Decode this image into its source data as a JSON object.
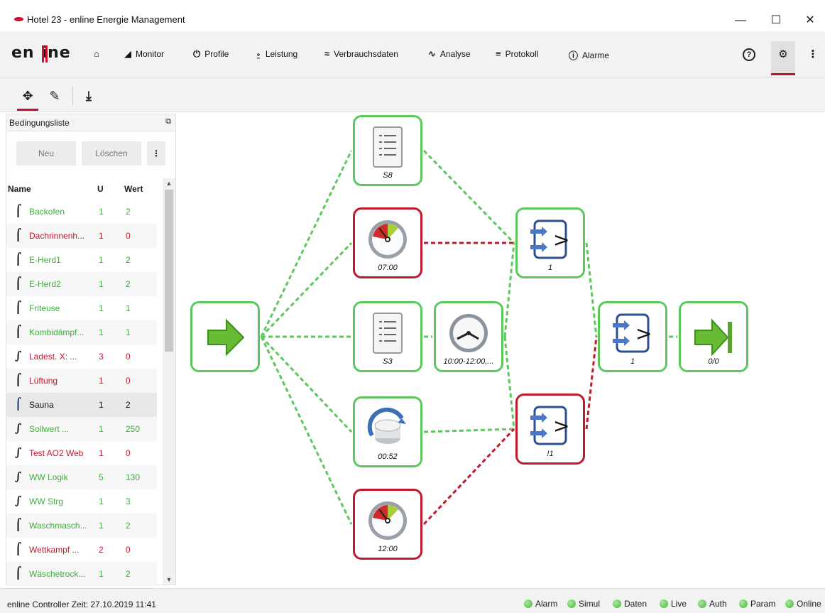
{
  "window": {
    "title": "Hotel 23 - enline Energie Management",
    "controls": [
      "—",
      "☐",
      "✕"
    ]
  },
  "brand": {
    "text": "enline"
  },
  "nav": [
    {
      "label": "",
      "icon": "home-icon",
      "glyph": "⌂"
    },
    {
      "label": "Monitor",
      "icon": "signal-icon",
      "glyph": "◢"
    },
    {
      "label": "Profile",
      "icon": "power-icon",
      "glyph": "⏻"
    },
    {
      "label": "Leistung",
      "icon": "plug-icon",
      "glyph": "⍛"
    },
    {
      "label": "Verbrauchsdaten",
      "icon": "trend-icon",
      "glyph": "≈"
    },
    {
      "label": "Analyse",
      "icon": "line-chart-icon",
      "glyph": "∿"
    },
    {
      "label": "Protokoll",
      "icon": "list-check-icon",
      "glyph": "≡"
    },
    {
      "label": "Alarme",
      "icon": "alert-icon",
      "glyph": "ⓘ"
    }
  ],
  "right_icons": [
    {
      "name": "help-icon",
      "glyph": "?"
    },
    {
      "name": "settings-icon",
      "glyph": "⚙"
    },
    {
      "name": "more-icon",
      "glyph": "⋮"
    }
  ],
  "toolbar": [
    {
      "name": "move-tool-icon",
      "glyph": "✥",
      "active": true
    },
    {
      "name": "edit-tool-icon",
      "glyph": "✎",
      "active": false
    },
    {
      "name": "download-icon",
      "glyph": "⤓",
      "active": false
    }
  ],
  "sidebar": {
    "title": "Bedingungsliste",
    "new_label": "Neu",
    "delete_label": "Löschen",
    "more_label": "⋮",
    "columns": {
      "name": "Name",
      "u": "U",
      "wert": "Wert"
    },
    "rows": [
      {
        "name": "Backofen",
        "u": "1",
        "w": "2",
        "color": "green"
      },
      {
        "name": "Dachrinnenh...",
        "u": "1",
        "w": "0",
        "color": "red"
      },
      {
        "name": "E-Herd1",
        "u": "1",
        "w": "2",
        "color": "green"
      },
      {
        "name": "E-Herd2",
        "u": "1",
        "w": "2",
        "color": "green"
      },
      {
        "name": "Friteuse",
        "u": "1",
        "w": "1",
        "color": "green"
      },
      {
        "name": "Kombidämpf...",
        "u": "1",
        "w": "1",
        "color": "green"
      },
      {
        "name": "Ladest. X: ...",
        "u": "3",
        "w": "0",
        "color": "red"
      },
      {
        "name": "Lüftung",
        "u": "1",
        "w": "0",
        "color": "red"
      },
      {
        "name": "Sauna",
        "u": "1",
        "w": "2",
        "color": "black"
      },
      {
        "name": "Sollwert ...",
        "u": "1",
        "w": "250",
        "color": "green"
      },
      {
        "name": "Test AO2 Web",
        "u": "1",
        "w": "0",
        "color": "red"
      },
      {
        "name": "WW Logik",
        "u": "5",
        "w": "130",
        "color": "green"
      },
      {
        "name": "WW Strg",
        "u": "1",
        "w": "3",
        "color": "green"
      },
      {
        "name": "Waschmasch...",
        "u": "1",
        "w": "2",
        "color": "green"
      },
      {
        "name": "Wettkampf ...",
        "u": "2",
        "w": "0",
        "color": "red"
      },
      {
        "name": "Wäschetrock...",
        "u": "1",
        "w": "2",
        "color": "green"
      }
    ]
  },
  "diagram": {
    "nodes": [
      {
        "id": "start",
        "kind": "start-arrow",
        "label": "",
        "state": "green"
      },
      {
        "id": "s8",
        "kind": "list",
        "label": "S8",
        "state": "green"
      },
      {
        "id": "gauge1",
        "kind": "gauge",
        "label": "07:00",
        "state": "red"
      },
      {
        "id": "s3",
        "kind": "list",
        "label": "S3",
        "state": "green"
      },
      {
        "id": "clock",
        "kind": "clock",
        "label": "10:00-12:00,...",
        "state": "green"
      },
      {
        "id": "knob",
        "kind": "knob",
        "label": "00:52",
        "state": "green"
      },
      {
        "id": "gauge2",
        "kind": "gauge",
        "label": "12:00",
        "state": "red"
      },
      {
        "id": "cmp1",
        "kind": "compare",
        "label": "1",
        "state": "green"
      },
      {
        "id": "cmp2",
        "kind": "compare",
        "label": "!1",
        "state": "red"
      },
      {
        "id": "cmp3",
        "kind": "compare",
        "label": "1",
        "state": "green"
      },
      {
        "id": "end",
        "kind": "end-arrow",
        "label": "0/0",
        "state": "green"
      }
    ],
    "edges": [
      {
        "from": "start",
        "to": "s8",
        "state": "green"
      },
      {
        "from": "start",
        "to": "gauge1",
        "state": "green"
      },
      {
        "from": "start",
        "to": "s3",
        "state": "green"
      },
      {
        "from": "start",
        "to": "knob",
        "state": "green"
      },
      {
        "from": "start",
        "to": "gauge2",
        "state": "green"
      },
      {
        "from": "s8",
        "to": "cmp1",
        "state": "green"
      },
      {
        "from": "gauge1",
        "to": "cmp1",
        "state": "red"
      },
      {
        "from": "s3",
        "to": "clock",
        "state": "green"
      },
      {
        "from": "clock",
        "to": "cmp1",
        "state": "green"
      },
      {
        "from": "clock",
        "to": "cmp2",
        "state": "green"
      },
      {
        "from": "knob",
        "to": "cmp2",
        "state": "green"
      },
      {
        "from": "gauge2",
        "to": "cmp2",
        "state": "red"
      },
      {
        "from": "cmp1",
        "to": "cmp3",
        "state": "green"
      },
      {
        "from": "cmp2",
        "to": "cmp3",
        "state": "red"
      },
      {
        "from": "cmp3",
        "to": "end",
        "state": "green"
      }
    ]
  },
  "status": {
    "text": "enline Controller Zeit: 27.10.2019 11:41",
    "indicators": [
      "Alarm",
      "Simul",
      "Daten",
      "Live",
      "Auth",
      "Param",
      "Online"
    ]
  },
  "colors": {
    "accent": "#c8102e",
    "ok": "#5cc85c",
    "fail": "#c0192d"
  }
}
